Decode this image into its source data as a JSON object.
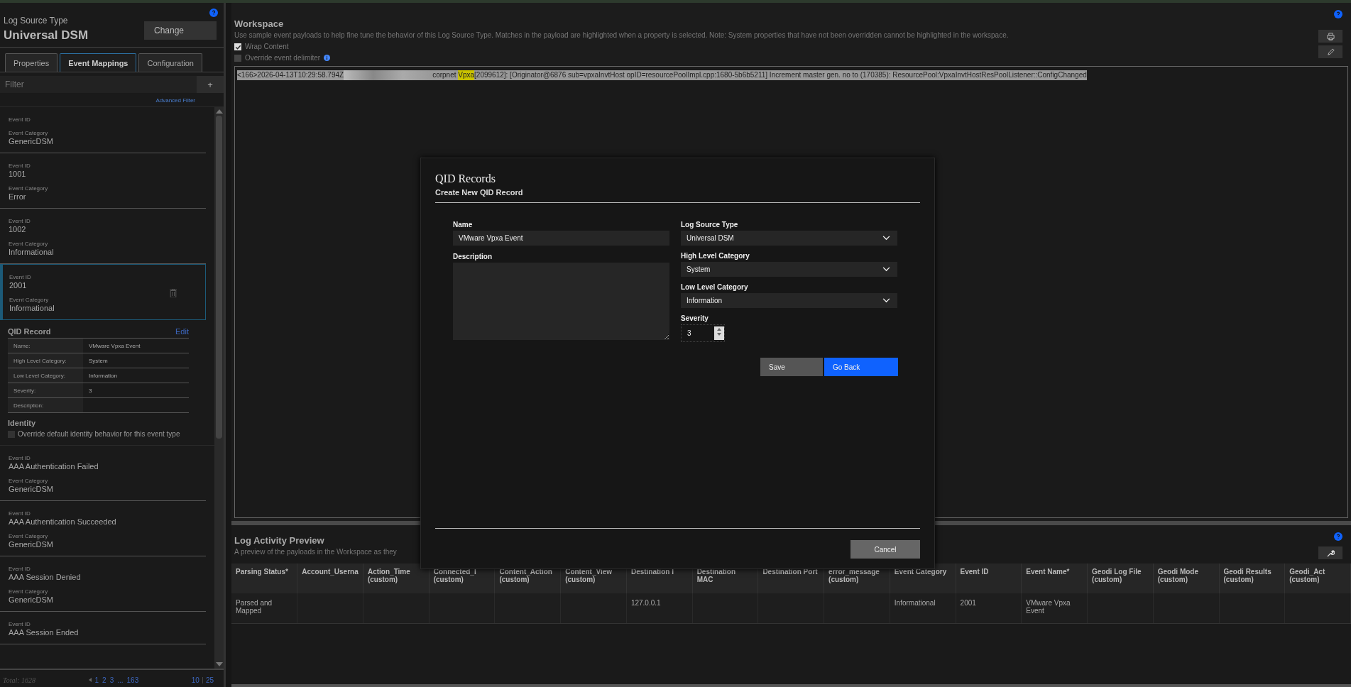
{
  "sidebar": {
    "label": "Log Source Type",
    "title": "Universal DSM",
    "change_button": "Change",
    "tabs": [
      {
        "label": "Properties",
        "selected": false
      },
      {
        "label": "Event Mappings",
        "selected": true
      },
      {
        "label": "Configuration",
        "selected": false
      }
    ],
    "filter": {
      "placeholder": "Filter",
      "add_button": "+"
    },
    "advanced_filter": "Advanced Filter",
    "events": [
      {
        "id_label": "Event ID",
        "category_label": "Event Category",
        "category": "GenericDSM",
        "selected": false
      },
      {
        "id_label": "Event ID",
        "event_id": "1001",
        "category_label": "Event Category",
        "category": "Error",
        "selected": false
      },
      {
        "id_label": "Event ID",
        "event_id": "1002",
        "category_label": "Event Category",
        "category": "Informational",
        "selected": false
      },
      {
        "id_label": "Event ID",
        "event_id": "2001",
        "category_label": "Event Category",
        "category": "Informational",
        "selected": true,
        "qid_record": {
          "title": "QID Record",
          "edit": "Edit",
          "rows": [
            [
              "Name:",
              "VMware Vpxa Event"
            ],
            [
              "High Level Category:",
              "System"
            ],
            [
              "Low Level Category:",
              "Information"
            ],
            [
              "Severity:",
              "3"
            ],
            [
              "Description:",
              null
            ]
          ]
        },
        "identity": {
          "title": "Identity",
          "checkbox_label": "Override default identity behavior for this event type",
          "checked": false
        }
      },
      {
        "id_label": "Event ID",
        "event_id": "AAA Authentication Failed",
        "category_label": "Event Category",
        "category": "GenericDSM",
        "selected": false
      },
      {
        "id_label": "Event ID",
        "event_id": "AAA Authentication Succeeded",
        "category_label": "Event Category",
        "category": "GenericDSM",
        "selected": false
      },
      {
        "id_label": "Event ID",
        "event_id": "AAA Session Denied",
        "category_label": "Event Category",
        "category": "GenericDSM",
        "selected": false
      },
      {
        "id_label": "Event ID",
        "event_id": "AAA Session Ended",
        "selected": false
      }
    ],
    "pagination": {
      "total": "Total: 1628",
      "pages": [
        "1",
        "2",
        "3",
        "...",
        "163"
      ],
      "page_sizes": [
        "10",
        "25"
      ]
    }
  },
  "workspace": {
    "title": "Workspace",
    "description": "Use sample event payloads to help fine tune the behavior of this Log Source Type. Matches in the payload are highlighted when a property is selected. Note: System properties that have not been overridden cannot be highlighted in the workspace.",
    "options": [
      {
        "label": "Wrap Content",
        "checked": true,
        "info": false
      },
      {
        "label": "Override event delimiter",
        "checked": false,
        "info": true
      }
    ],
    "payload": [
      {
        "kind": "text",
        "text": "<166>2026-04-13T10:29:58.794Z"
      },
      {
        "kind": "redacted"
      },
      {
        "kind": "text",
        "text": "corpnet "
      },
      {
        "kind": "match",
        "text": "Vpxa"
      },
      {
        "kind": "text",
        "text": "[2099612]: [Originator@6876 sub=vpxaInvtHost opID=resourcePoolImpl.cpp:1680-5b6b5211] Increment master gen. no to (170385): ResourcePool:VpxaInvtHostResPoolListener::ConfigChanged"
      }
    ]
  },
  "preview": {
    "title": "Log Activity Preview",
    "description": "A preview of the payloads in the Workspace as they",
    "table": {
      "columns": [
        "Parsing Status*",
        "Account_Userna",
        "Action_Time (custom)",
        "Connected_I (custom)",
        "Content_Action (custom)",
        "Content_View (custom)",
        "Destination I",
        "Destination MAC",
        "Destination Port",
        "error_message (custom)",
        "Event Category",
        "Event ID",
        "Event Name*",
        "Geodi Log File (custom)",
        "Geodi Mode (custom)",
        "Geodi Results (custom)",
        "Geodi_Act (custom)"
      ],
      "rows": [
        [
          "Parsed and Mapped",
          null,
          null,
          null,
          null,
          null,
          "127.0.0.1",
          null,
          null,
          null,
          "Informational",
          "2001",
          "VMware Vpxa Event",
          null,
          null,
          null,
          null
        ]
      ]
    }
  },
  "modal": {
    "title": "QID Records",
    "subtitle": "Create New QID Record",
    "name": {
      "label": "Name",
      "value": "VMware Vpxa Event"
    },
    "description": {
      "label": "Description"
    },
    "selects": [
      {
        "label": "Log Source Type",
        "value": "Universal DSM"
      },
      {
        "label": "High Level Category",
        "value": "System"
      },
      {
        "label": "Low Level Category",
        "value": "Information"
      }
    ],
    "severity": {
      "label": "Severity",
      "value": "3"
    },
    "buttons": [
      {
        "label": "Save",
        "kind": "secondary"
      },
      {
        "label": "Go Back",
        "kind": "primary"
      }
    ],
    "cancel": "Cancel"
  }
}
